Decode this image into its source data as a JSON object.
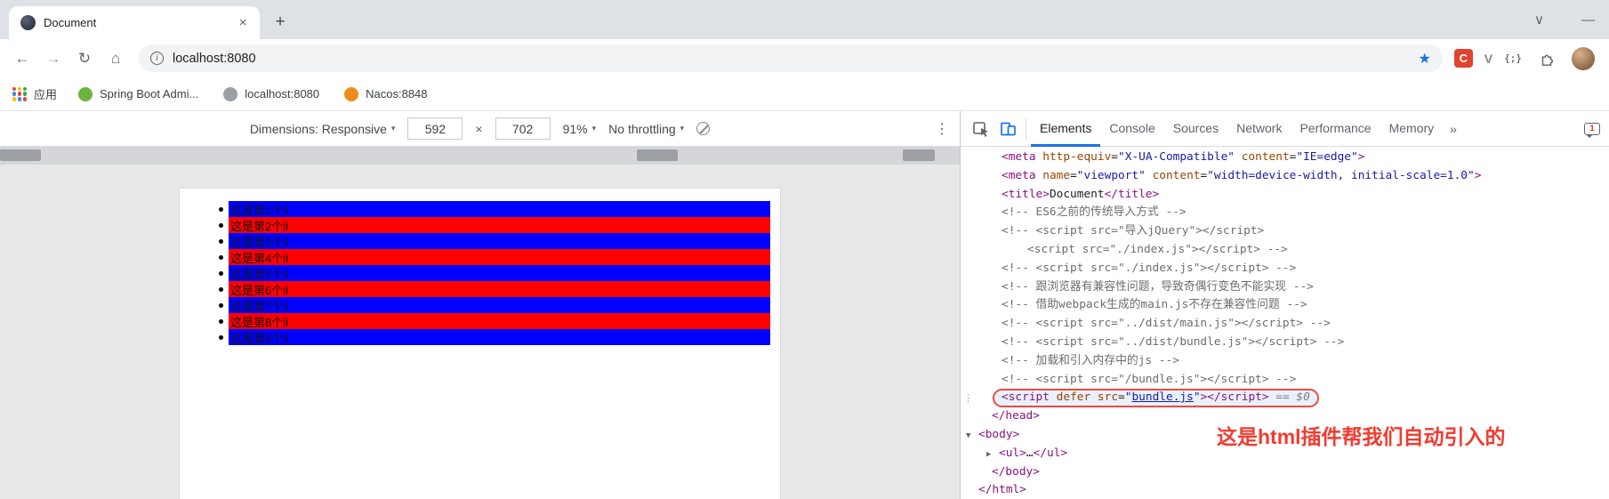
{
  "window": {
    "tab_title": "Document",
    "url": "localhost:8080"
  },
  "icons": {
    "close": "×",
    "new_tab": "+",
    "tab_search": "∨",
    "minimize": "—",
    "back": "←",
    "forward": "→",
    "reload": "↻",
    "home": "⌂",
    "star": "★",
    "info": "i",
    "more_vert": "⋮",
    "overflow": "»",
    "caret": "▾",
    "multiply": "×",
    "tree_down": "▼",
    "tree_right": "▶",
    "node_menu": "⋮",
    "braces": "{;}",
    "ext_c": "C",
    "ext_v": "V"
  },
  "bookmarks": {
    "apps_label": "应用",
    "items": [
      {
        "id": "spring-boot-admin",
        "label": "Spring Boot Admi...",
        "icon": "spring-boot-icon",
        "color": "#6db33f"
      },
      {
        "id": "localhost-8080",
        "label": "localhost:8080",
        "icon": "globe-icon",
        "color": "#9aa0a6"
      },
      {
        "id": "nacos-8848",
        "label": "Nacos:8848",
        "icon": "nacos-icon",
        "color": "#f08c1e"
      }
    ]
  },
  "device_toolbar": {
    "dimensions_label": "Dimensions: Responsive",
    "width": "592",
    "height": "702",
    "zoom": "91%",
    "throttling": "No throttling"
  },
  "page": {
    "list_items": [
      {
        "text": "这是第1个li",
        "color": "#0000fe"
      },
      {
        "text": "这是第2个li",
        "color": "#fd0000"
      },
      {
        "text": "这是第3个li",
        "color": "#0000fe"
      },
      {
        "text": "这是第4个li",
        "color": "#fd0000"
      },
      {
        "text": "这是第5个li",
        "color": "#0000fe"
      },
      {
        "text": "这是第6个li",
        "color": "#fd0000"
      },
      {
        "text": "这是第7个li",
        "color": "#0000fe"
      },
      {
        "text": "这是第8个li",
        "color": "#fd0000"
      },
      {
        "text": "这是第9个li",
        "color": "#0000fe"
      }
    ]
  },
  "devtools": {
    "tabs": [
      {
        "label": "Elements",
        "active": true
      },
      {
        "label": "Console",
        "active": false
      },
      {
        "label": "Sources",
        "active": false
      },
      {
        "label": "Network",
        "active": false
      },
      {
        "label": "Performance",
        "active": false
      },
      {
        "label": "Memory",
        "active": false
      }
    ],
    "message_count": "1",
    "annotation": "这是html插件帮我们自动引入的",
    "annotation_color": "#f23b2f",
    "code_lines": [
      {
        "indent": 46,
        "segments": [
          [
            "tag",
            "<meta"
          ],
          [
            "plain",
            " "
          ],
          [
            "attr",
            "http-equiv"
          ],
          [
            "plain",
            "="
          ],
          [
            "val",
            "\"X-UA-Compatible\""
          ],
          [
            "plain",
            " "
          ],
          [
            "attr",
            "content"
          ],
          [
            "plain",
            "="
          ],
          [
            "val",
            "\"IE=edge\""
          ],
          [
            "tag",
            ">"
          ]
        ]
      },
      {
        "indent": 46,
        "segments": [
          [
            "tag",
            "<meta"
          ],
          [
            "plain",
            " "
          ],
          [
            "attr",
            "name"
          ],
          [
            "plain",
            "="
          ],
          [
            "val",
            "\"viewport\""
          ],
          [
            "plain",
            " "
          ],
          [
            "attr",
            "content"
          ],
          [
            "plain",
            "="
          ],
          [
            "val",
            "\"width=device-width, initial-scale=1.0\""
          ],
          [
            "tag",
            ">"
          ]
        ]
      },
      {
        "indent": 46,
        "segments": [
          [
            "tag",
            "<title>"
          ],
          [
            "plain",
            "Document"
          ],
          [
            "tag",
            "</title>"
          ]
        ]
      },
      {
        "indent": 46,
        "segments": [
          [
            "com",
            "<!-- ES6之前的传统导入方式 -->"
          ]
        ]
      },
      {
        "indent": 46,
        "segments": [
          [
            "com",
            "<!-- <script src=\"导入jQuery\"></script>"
          ]
        ]
      },
      {
        "indent": 75,
        "segments": [
          [
            "com",
            "<script src=\"./index.js\"></script> -->"
          ]
        ]
      },
      {
        "indent": 46,
        "segments": [
          [
            "com",
            "<!-- <script src=\"./index.js\"></script> -->"
          ]
        ]
      },
      {
        "indent": 46,
        "segments": [
          [
            "com",
            "<!-- 跟浏览器有兼容性问题，导致奇偶行变色不能实现 -->"
          ]
        ]
      },
      {
        "indent": 46,
        "segments": [
          [
            "com",
            "<!-- 借助webpack生成的main.js不存在兼容性问题 -->"
          ]
        ]
      },
      {
        "indent": 46,
        "segments": [
          [
            "com",
            "<!-- <script src=\"../dist/main.js\"></script> -->"
          ]
        ]
      },
      {
        "indent": 46,
        "segments": [
          [
            "com",
            "<!-- <script src=\"../dist/bundle.js\"></script> -->"
          ]
        ]
      },
      {
        "indent": 46,
        "segments": [
          [
            "com",
            "<!-- 加载和引入内存中的js -->"
          ]
        ]
      },
      {
        "indent": 46,
        "segments": [
          [
            "com",
            "<!-- <script src=\"/bundle.js\"></script> -->"
          ]
        ]
      },
      {
        "indent": 46,
        "selected": true,
        "segments": [
          [
            "tag",
            "<script"
          ],
          [
            "plain",
            " "
          ],
          [
            "attr",
            "defer"
          ],
          [
            "plain",
            " "
          ],
          [
            "attr",
            "src"
          ],
          [
            "plain",
            "="
          ],
          [
            "val",
            "\""
          ],
          [
            "link",
            "bundle.js"
          ],
          [
            "val",
            "\""
          ],
          [
            "tag",
            "></script>"
          ],
          [
            "meta",
            " == $0"
          ]
        ]
      },
      {
        "indent": 35,
        "segments": [
          [
            "tag",
            "</head>"
          ]
        ]
      },
      {
        "indent": 20,
        "arrow": "down",
        "segments": [
          [
            "tag",
            "<body>"
          ]
        ]
      },
      {
        "indent": 43,
        "arrow": "right",
        "segments": [
          [
            "tag",
            "<ul>"
          ],
          [
            "plain",
            "…"
          ],
          [
            "tag",
            "</ul>"
          ]
        ]
      },
      {
        "indent": 35,
        "segments": [
          [
            "tag",
            "</body>"
          ]
        ]
      },
      {
        "indent": 20,
        "segments": [
          [
            "tag",
            "</html>"
          ]
        ]
      }
    ]
  },
  "colors": {
    "accent_blue": "#1a73e8",
    "selection_border_red": "#ee4b40",
    "badge_red": "#d93025"
  }
}
